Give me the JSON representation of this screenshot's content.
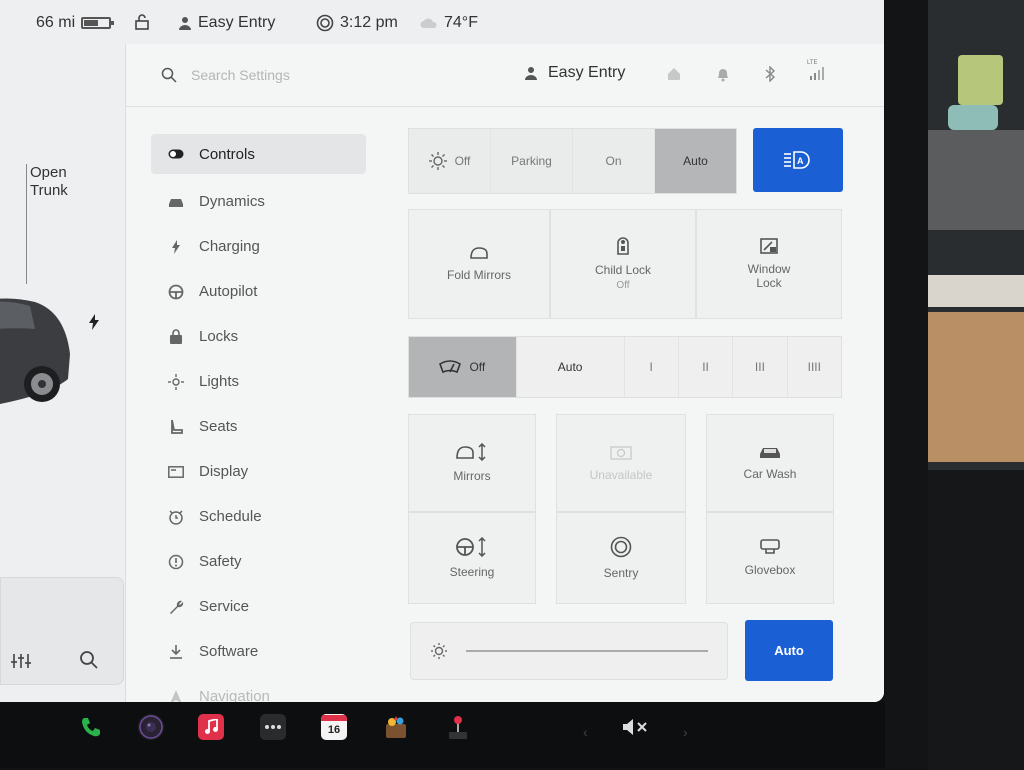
{
  "status": {
    "range": "66 mi",
    "battery_level": 0.6,
    "profile": "Easy Entry",
    "time": "3:12 pm",
    "temperature": "74°F"
  },
  "car_panel": {
    "open_trunk_line1": "Open",
    "open_trunk_line2": "Trunk"
  },
  "settings": {
    "search_placeholder": "Search Settings",
    "profile_name": "Easy Entry",
    "connectivity": "LTE",
    "nav": [
      {
        "label": "Controls",
        "icon": "toggle-icon",
        "active": true
      },
      {
        "label": "Dynamics",
        "icon": "car-icon"
      },
      {
        "label": "Charging",
        "icon": "bolt-icon"
      },
      {
        "label": "Autopilot",
        "icon": "steering-wheel-icon"
      },
      {
        "label": "Locks",
        "icon": "lock-icon"
      },
      {
        "label": "Lights",
        "icon": "light-icon"
      },
      {
        "label": "Seats",
        "icon": "seat-icon"
      },
      {
        "label": "Display",
        "icon": "display-icon"
      },
      {
        "label": "Schedule",
        "icon": "schedule-icon"
      },
      {
        "label": "Safety",
        "icon": "safety-icon"
      },
      {
        "label": "Service",
        "icon": "wrench-icon"
      },
      {
        "label": "Software",
        "icon": "download-icon"
      },
      {
        "label": "Navigation",
        "icon": "navigation-icon"
      }
    ]
  },
  "controls": {
    "lights": {
      "options": [
        "Off",
        "Parking",
        "On",
        "Auto"
      ],
      "selected": "Auto"
    },
    "tiles_row1": [
      {
        "label": "Fold Mirrors",
        "icon": "mirror-icon"
      },
      {
        "label": "Child Lock",
        "sub": "Off",
        "icon": "child-lock-icon"
      },
      {
        "label": "Window Lock",
        "icon": "window-lock-icon"
      }
    ],
    "wipers": {
      "options": [
        "Off",
        "Auto",
        "I",
        "II",
        "III",
        "IIII"
      ],
      "selected": "Off"
    },
    "tiles_row2": [
      {
        "label": "Mirrors",
        "icon": "mirror-adjust-icon"
      },
      {
        "label": "Unavailable",
        "icon": "camera-icon",
        "disabled": true
      },
      {
        "label": "Car Wash",
        "icon": "car-wash-icon"
      }
    ],
    "tiles_row3": [
      {
        "label": "Steering",
        "icon": "steering-adjust-icon"
      },
      {
        "label": "Sentry",
        "icon": "sentry-icon"
      },
      {
        "label": "Glovebox",
        "icon": "glovebox-icon"
      }
    ],
    "brightness_auto_label": "Auto"
  },
  "taskbar": {
    "calendar_day": "16",
    "icons": [
      "phone-icon",
      "camera-icon",
      "music-icon",
      "more-icon",
      "calendar-icon",
      "toybox-icon",
      "arcade-icon",
      "mute-icon"
    ]
  },
  "colors": {
    "accent_blue": "#1a5fd4",
    "phone_green": "#2bb24c",
    "music_red": "#e0314b"
  }
}
